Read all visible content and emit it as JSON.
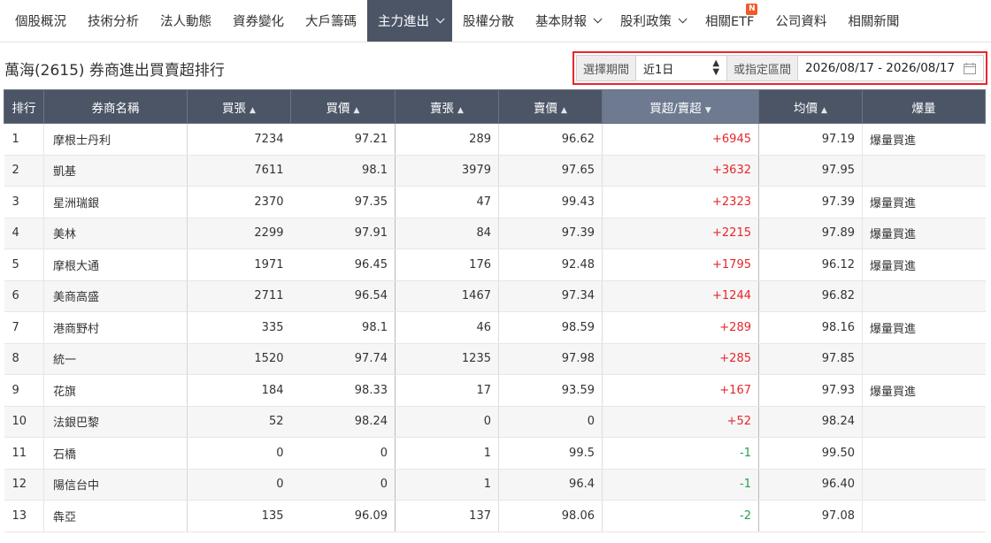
{
  "nav": {
    "items": [
      {
        "label": "個股概況",
        "active": false,
        "dropdown": false
      },
      {
        "label": "技術分析",
        "active": false,
        "dropdown": false
      },
      {
        "label": "法人動態",
        "active": false,
        "dropdown": false
      },
      {
        "label": "資券變化",
        "active": false,
        "dropdown": false
      },
      {
        "label": "大戶籌碼",
        "active": false,
        "dropdown": false
      },
      {
        "label": "主力進出",
        "active": true,
        "dropdown": true
      },
      {
        "label": "股權分散",
        "active": false,
        "dropdown": false
      },
      {
        "label": "基本財報",
        "active": false,
        "dropdown": true
      },
      {
        "label": "股利政策",
        "active": false,
        "dropdown": true
      },
      {
        "label": "相關ETF",
        "active": false,
        "dropdown": false,
        "badge": "N"
      },
      {
        "label": "公司資料",
        "active": false,
        "dropdown": false
      },
      {
        "label": "相關新聞",
        "active": false,
        "dropdown": false
      }
    ]
  },
  "page": {
    "title": "萬海(2615) 券商進出買賣超排行"
  },
  "filter": {
    "period_label": "選擇期間",
    "period_value": "近1日",
    "range_label": "或指定區間",
    "range_value": "2026/08/17 - 2026/08/17"
  },
  "colors": {
    "header_bg": "#4b5566",
    "active_header_bg": "#6d7a90",
    "positive": "#e8262a",
    "negative": "#1fa34a",
    "highlight_border": "#e8262a"
  },
  "table": {
    "columns": [
      {
        "label": "排行",
        "sortable": false
      },
      {
        "label": "券商名稱",
        "sortable": false
      },
      {
        "label": "買張",
        "sortable": true
      },
      {
        "label": "買價",
        "sortable": true
      },
      {
        "label": "賣張",
        "sortable": true
      },
      {
        "label": "賣價",
        "sortable": true
      },
      {
        "label": "買超/賣超",
        "sortable": true,
        "active": true
      },
      {
        "label": "均價",
        "sortable": true
      },
      {
        "label": "爆量",
        "sortable": false
      }
    ],
    "rows": [
      {
        "rank": "1",
        "broker": "摩根士丹利",
        "buy_qty": "7234",
        "buy_price": "97.21",
        "sell_qty": "289",
        "sell_price": "96.62",
        "net": "+6945",
        "avg": "97.19",
        "burst": "爆量買進"
      },
      {
        "rank": "2",
        "broker": "凱基",
        "buy_qty": "7611",
        "buy_price": "98.1",
        "sell_qty": "3979",
        "sell_price": "97.65",
        "net": "+3632",
        "avg": "97.95",
        "burst": ""
      },
      {
        "rank": "3",
        "broker": "星洲瑞銀",
        "buy_qty": "2370",
        "buy_price": "97.35",
        "sell_qty": "47",
        "sell_price": "99.43",
        "net": "+2323",
        "avg": "97.39",
        "burst": "爆量買進"
      },
      {
        "rank": "4",
        "broker": "美林",
        "buy_qty": "2299",
        "buy_price": "97.91",
        "sell_qty": "84",
        "sell_price": "97.39",
        "net": "+2215",
        "avg": "97.89",
        "burst": "爆量買進"
      },
      {
        "rank": "5",
        "broker": "摩根大通",
        "buy_qty": "1971",
        "buy_price": "96.45",
        "sell_qty": "176",
        "sell_price": "92.48",
        "net": "+1795",
        "avg": "96.12",
        "burst": "爆量買進"
      },
      {
        "rank": "6",
        "broker": "美商高盛",
        "buy_qty": "2711",
        "buy_price": "96.54",
        "sell_qty": "1467",
        "sell_price": "97.34",
        "net": "+1244",
        "avg": "96.82",
        "burst": ""
      },
      {
        "rank": "7",
        "broker": "港商野村",
        "buy_qty": "335",
        "buy_price": "98.1",
        "sell_qty": "46",
        "sell_price": "98.59",
        "net": "+289",
        "avg": "98.16",
        "burst": "爆量買進"
      },
      {
        "rank": "8",
        "broker": "統一",
        "buy_qty": "1520",
        "buy_price": "97.74",
        "sell_qty": "1235",
        "sell_price": "97.98",
        "net": "+285",
        "avg": "97.85",
        "burst": ""
      },
      {
        "rank": "9",
        "broker": "花旗",
        "buy_qty": "184",
        "buy_price": "98.33",
        "sell_qty": "17",
        "sell_price": "93.59",
        "net": "+167",
        "avg": "97.93",
        "burst": "爆量買進"
      },
      {
        "rank": "10",
        "broker": "法銀巴黎",
        "buy_qty": "52",
        "buy_price": "98.24",
        "sell_qty": "0",
        "sell_price": "0",
        "net": "+52",
        "avg": "98.24",
        "burst": ""
      },
      {
        "rank": "11",
        "broker": "石橋",
        "buy_qty": "0",
        "buy_price": "0",
        "sell_qty": "1",
        "sell_price": "99.5",
        "net": "-1",
        "avg": "99.50",
        "burst": ""
      },
      {
        "rank": "12",
        "broker": "陽信台中",
        "buy_qty": "0",
        "buy_price": "0",
        "sell_qty": "1",
        "sell_price": "96.4",
        "net": "-1",
        "avg": "96.40",
        "burst": ""
      },
      {
        "rank": "13",
        "broker": "犇亞",
        "buy_qty": "135",
        "buy_price": "96.09",
        "sell_qty": "137",
        "sell_price": "98.06",
        "net": "-2",
        "avg": "97.08",
        "burst": ""
      }
    ]
  }
}
